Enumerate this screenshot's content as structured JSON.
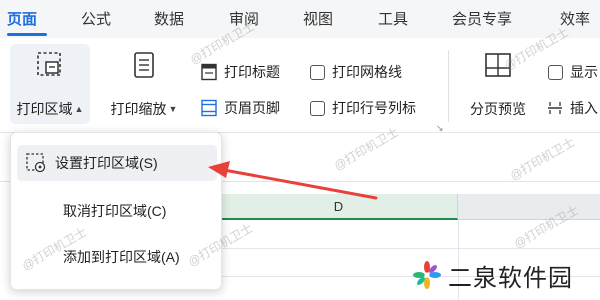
{
  "tabs": [
    {
      "label": "页面",
      "active": true
    },
    {
      "label": "公式"
    },
    {
      "label": "数据"
    },
    {
      "label": "审阅"
    },
    {
      "label": "视图"
    },
    {
      "label": "工具"
    },
    {
      "label": "会员专享"
    },
    {
      "label": "效率"
    }
  ],
  "ribbon": {
    "print_area": "打印区域",
    "print_scale": "打印缩放",
    "print_titles": "打印标题",
    "header_footer": "页眉页脚",
    "print_gridlines": "打印网格线",
    "print_row_col_headers": "打印行号列标",
    "page_break_preview": "分页预览",
    "show": "显示",
    "insert": "插入"
  },
  "menu": {
    "items": [
      {
        "label": "设置打印区域(S)",
        "icon": "set-print-area-icon"
      },
      {
        "label": "取消打印区域(C)"
      },
      {
        "label": "添加到打印区域(A)"
      }
    ]
  },
  "sheet": {
    "column_d": "D"
  },
  "watermark": "@打印机卫士",
  "brand": {
    "name": "二泉软件园"
  },
  "colors": {
    "accent": "#1f6fe0",
    "arrow": "#e8413c",
    "selected_column": "#1e8d4e"
  }
}
